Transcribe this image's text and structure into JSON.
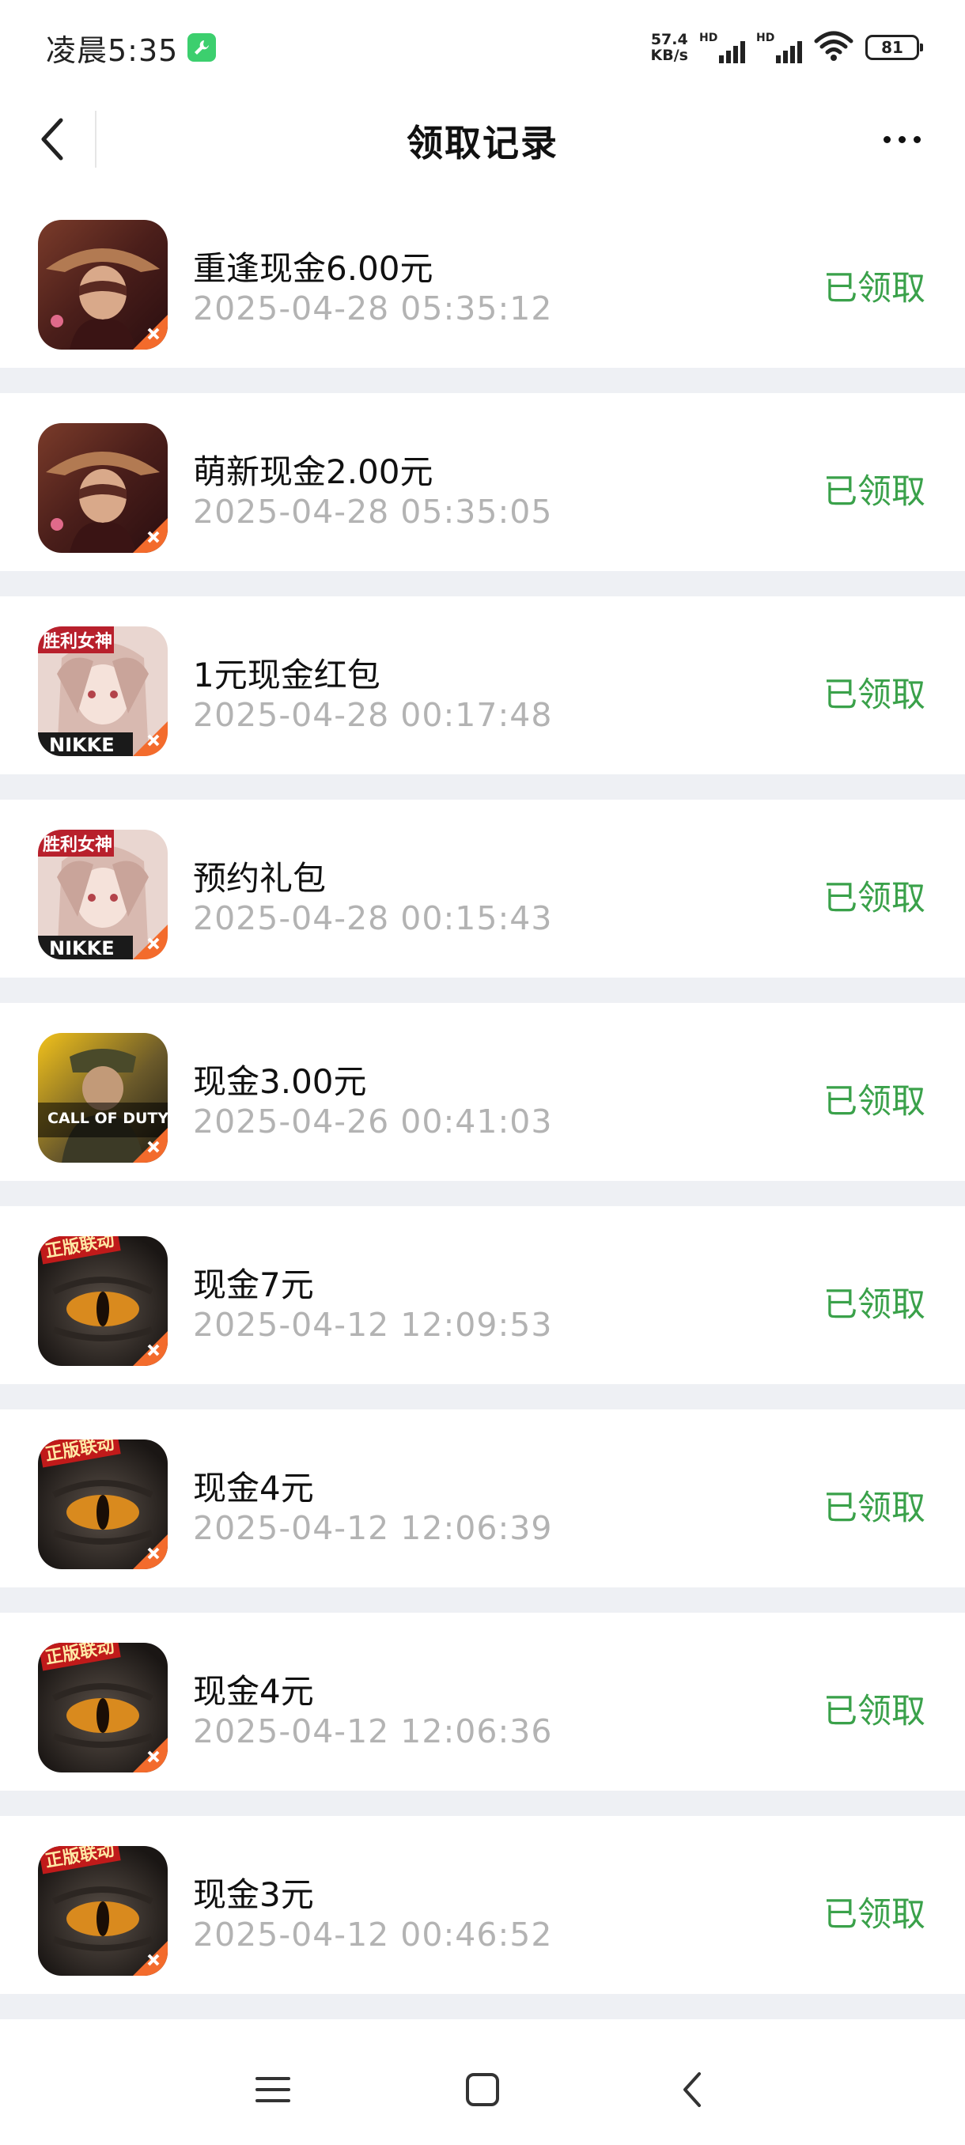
{
  "status_bar": {
    "time": "凌晨5:35",
    "net_speed_value": "57.4",
    "net_speed_unit": "KB/s",
    "signal_label_1": "HD",
    "signal_label_2": "HD",
    "battery": "81"
  },
  "header": {
    "title": "领取记录"
  },
  "records": [
    {
      "icon": "game-icon-hat-warrior",
      "title": "重逢现金6.00元",
      "time": "2025-04-28 05:35:12",
      "status": "已领取"
    },
    {
      "icon": "game-icon-hat-warrior",
      "title": "萌新现金2.00元",
      "time": "2025-04-28 05:35:05",
      "status": "已领取"
    },
    {
      "icon": "game-icon-nikke",
      "title": "1元现金红包",
      "time": "2025-04-28 00:17:48",
      "status": "已领取"
    },
    {
      "icon": "game-icon-nikke",
      "title": "预约礼包",
      "time": "2025-04-28 00:15:43",
      "status": "已领取"
    },
    {
      "icon": "game-icon-call-of-duty",
      "title": "现金3.00元",
      "time": "2025-04-26 00:41:03",
      "status": "已领取"
    },
    {
      "icon": "game-icon-dragon-eye",
      "title": "现金7元",
      "time": "2025-04-12 12:09:53",
      "status": "已领取"
    },
    {
      "icon": "game-icon-dragon-eye",
      "title": "现金4元",
      "time": "2025-04-12 12:06:39",
      "status": "已领取"
    },
    {
      "icon": "game-icon-dragon-eye",
      "title": "现金4元",
      "time": "2025-04-12 12:06:36",
      "status": "已领取"
    },
    {
      "icon": "game-icon-dragon-eye",
      "title": "现金3元",
      "time": "2025-04-12 00:46:52",
      "status": "已领取"
    }
  ],
  "icon_text": {
    "nikke_top": "胜利女神",
    "nikke_bottom": "NIKKE",
    "cod_line1": "CALL OF DUTY",
    "dragon_badge": "正版联动"
  },
  "colors": {
    "status_green": "#3aa14a",
    "time_gray": "#b3b3b3",
    "separator": "#eef0f4"
  }
}
